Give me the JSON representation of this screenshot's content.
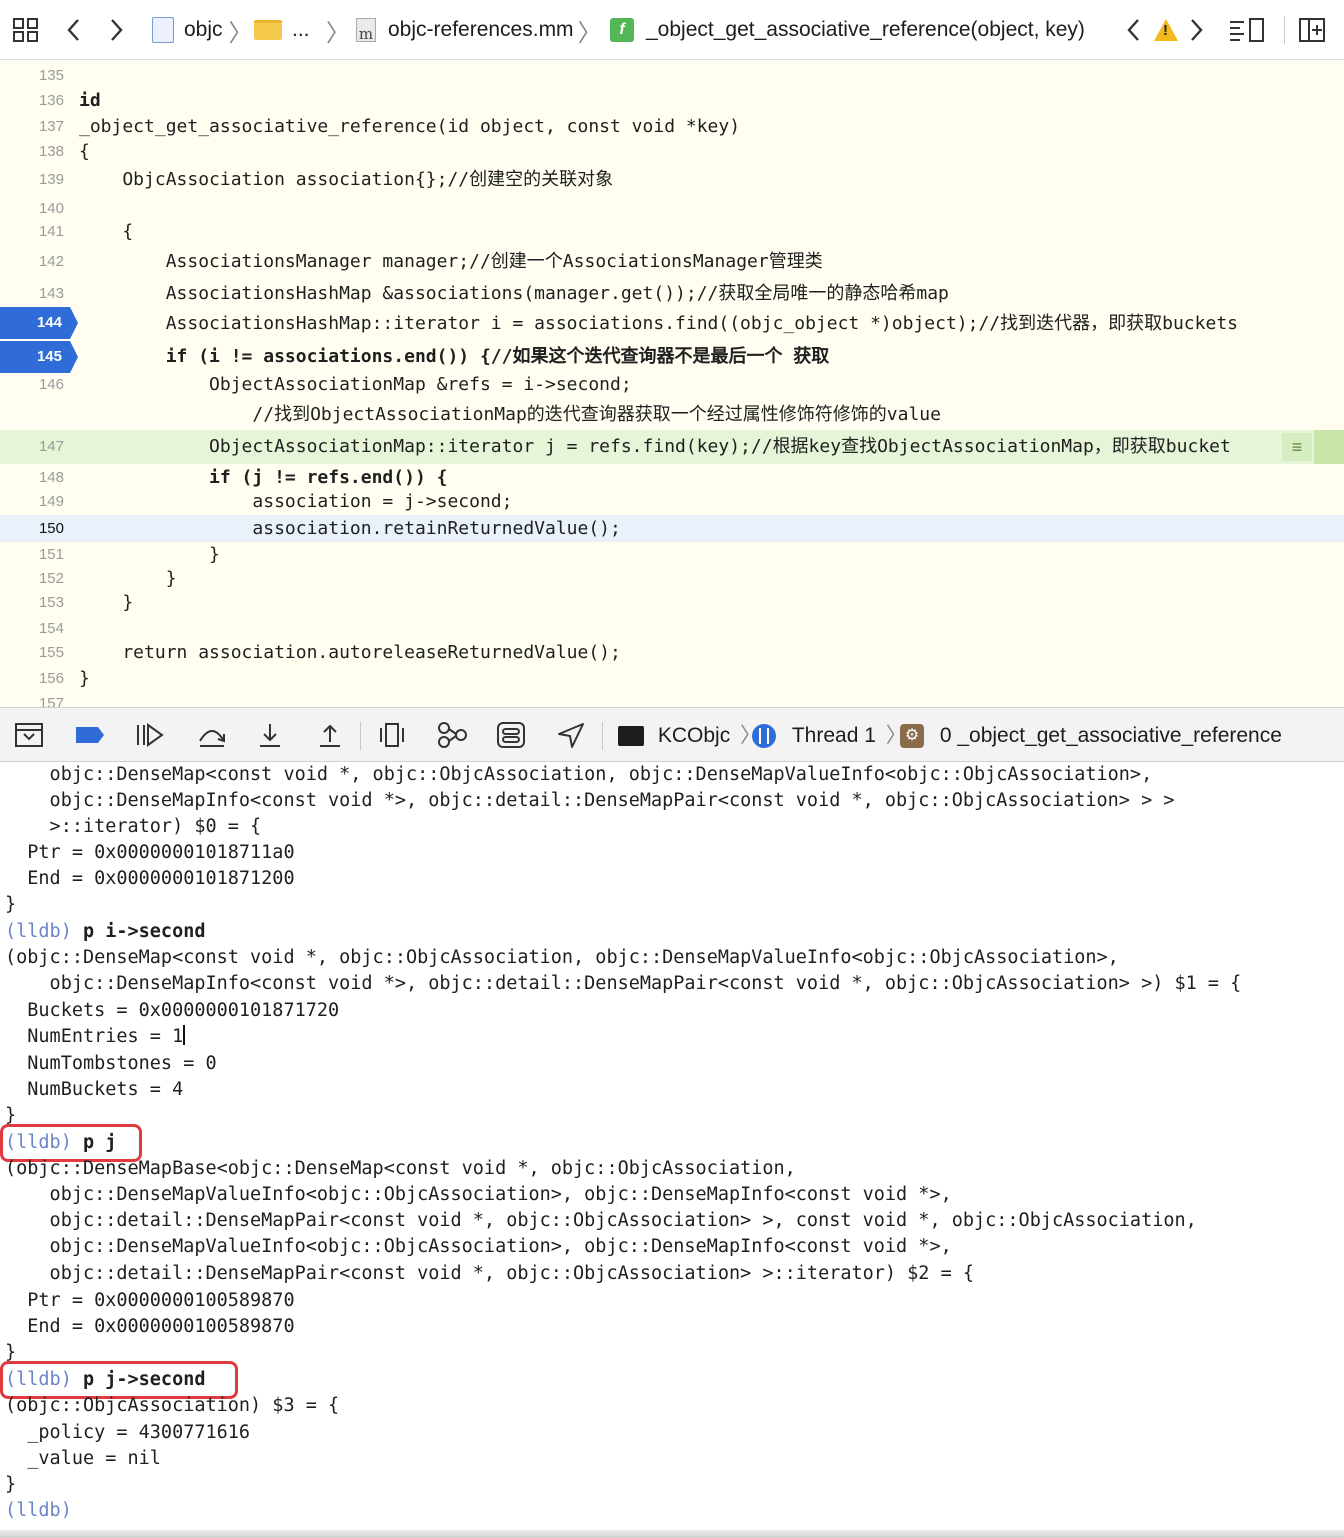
{
  "jumpbar": {
    "project": "objc",
    "ellipsis": "...",
    "file": "objc-references.mm",
    "function": "_object_get_associative_reference(object, key)"
  },
  "editor": {
    "lines": [
      {
        "n": "135",
        "code": ""
      },
      {
        "n": "136",
        "code": "id"
      },
      {
        "n": "137",
        "code": "_object_get_associative_reference(id object, const void *key)"
      },
      {
        "n": "138",
        "code": "{"
      },
      {
        "n": "139",
        "code": "    ObjcAssociation association{};//创建空的关联对象"
      },
      {
        "n": "140",
        "code": ""
      },
      {
        "n": "141",
        "code": "    {"
      },
      {
        "n": "142",
        "code": "        AssociationsManager manager;//创建一个AssociationsManager管理类"
      },
      {
        "n": "143",
        "code": "        AssociationsHashMap &associations(manager.get());//获取全局唯一的静态哈希map"
      },
      {
        "n": "144",
        "code": "        AssociationsHashMap::iterator i = associations.find((objc_object *)object);//找到迭代器，即获取buckets"
      },
      {
        "n": "145",
        "code": "        if (i != associations.end()) {//如果这个迭代查询器不是最后一个 获取"
      },
      {
        "n": "146",
        "code": "            ObjectAssociationMap &refs = i->second;"
      },
      {
        "n": "",
        "code": "                //找到ObjectAssociationMap的迭代查询器获取一个经过属性修饰符修饰的value"
      },
      {
        "n": "147",
        "code": "            ObjectAssociationMap::iterator j = refs.find(key);//根据key查找ObjectAssociationMap，即获取bucket"
      },
      {
        "n": "148",
        "code": "            if (j != refs.end()) {"
      },
      {
        "n": "149",
        "code": "                association = j->second;"
      },
      {
        "n": "150",
        "code": "                association.retainReturnedValue();"
      },
      {
        "n": "151",
        "code": "            }"
      },
      {
        "n": "152",
        "code": "        }"
      },
      {
        "n": "153",
        "code": "    }"
      },
      {
        "n": "154",
        "code": ""
      },
      {
        "n": "155",
        "code": "    return association.autoreleaseReturnedValue();"
      },
      {
        "n": "156",
        "code": "}"
      },
      {
        "n": "157",
        "code": ""
      }
    ]
  },
  "debugbar": {
    "target": "KCObjc",
    "thread": "Thread 1",
    "frame": "0 _object_get_associative_reference"
  },
  "console": {
    "lines": [
      "    objc::DenseMap<const void *, objc::ObjcAssociation, objc::DenseMapValueInfo<objc::ObjcAssociation>,",
      "    objc::DenseMapInfo<const void *>, objc::detail::DenseMapPair<const void *, objc::ObjcAssociation> > >",
      "    >::iterator) $0 = {",
      "  Ptr = 0x00000001018711a0",
      "  End = 0x0000000101871200",
      "}",
      "(lldb) p i->second",
      "(objc::DenseMap<const void *, objc::ObjcAssociation, objc::DenseMapValueInfo<objc::ObjcAssociation>,",
      "    objc::DenseMapInfo<const void *>, objc::detail::DenseMapPair<const void *, objc::ObjcAssociation> >) $1 = {",
      "  Buckets = 0x0000000101871720",
      "  NumEntries = 1",
      "  NumTombstones = 0",
      "  NumBuckets = 4",
      "}",
      "(lldb) p j",
      "(objc::DenseMapBase<objc::DenseMap<const void *, objc::ObjcAssociation,",
      "    objc::DenseMapValueInfo<objc::ObjcAssociation>, objc::DenseMapInfo<const void *>,",
      "    objc::detail::DenseMapPair<const void *, objc::ObjcAssociation> >, const void *, objc::ObjcAssociation,",
      "    objc::DenseMapValueInfo<objc::ObjcAssociation>, objc::DenseMapInfo<const void *>,",
      "    objc::detail::DenseMapPair<const void *, objc::ObjcAssociation> >::iterator) $2 = {",
      "  Ptr = 0x0000000100589870",
      "  End = 0x0000000100589870",
      "}",
      "(lldb) p j->second",
      "(objc::ObjcAssociation) $3 = {",
      "  _policy = 4300771616",
      "  _value = nil",
      "}",
      "(lldb)"
    ]
  },
  "colors": {
    "breakpoint": "#2f6cd8",
    "keyword": "#9b2393",
    "comment": "#5d8c18",
    "prompt": "#6a84c9",
    "highlight_box": "#e0393e"
  }
}
